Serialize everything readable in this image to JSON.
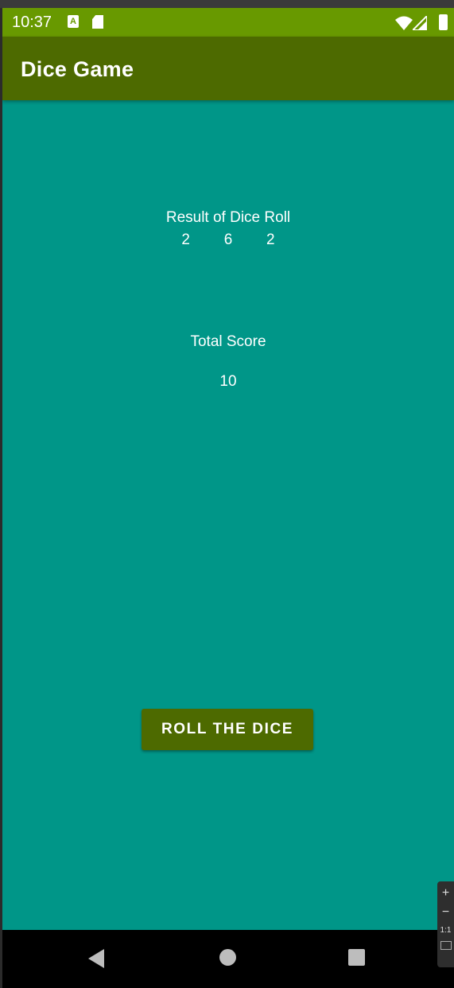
{
  "status_bar": {
    "time": "10:37",
    "a_label": "A"
  },
  "app_bar": {
    "title": "Dice Game"
  },
  "result": {
    "title": "Result of Dice Roll",
    "dice": [
      "2",
      "6",
      "2"
    ]
  },
  "score": {
    "title": "Total Score",
    "value": "10"
  },
  "roll_button": {
    "label": "ROLL THE DICE"
  },
  "zoom_panel": {
    "plus": "+",
    "minus": "−",
    "ratio": "1:1"
  },
  "colors": {
    "background": "#009688",
    "status_bar": "#689900",
    "app_bar": "#4d6a00",
    "button": "#4d6a00"
  },
  "icons": [
    "a-app-icon",
    "sd-card-icon",
    "wifi-icon",
    "signal-icon",
    "battery-icon",
    "back-icon",
    "home-icon",
    "recents-icon"
  ]
}
